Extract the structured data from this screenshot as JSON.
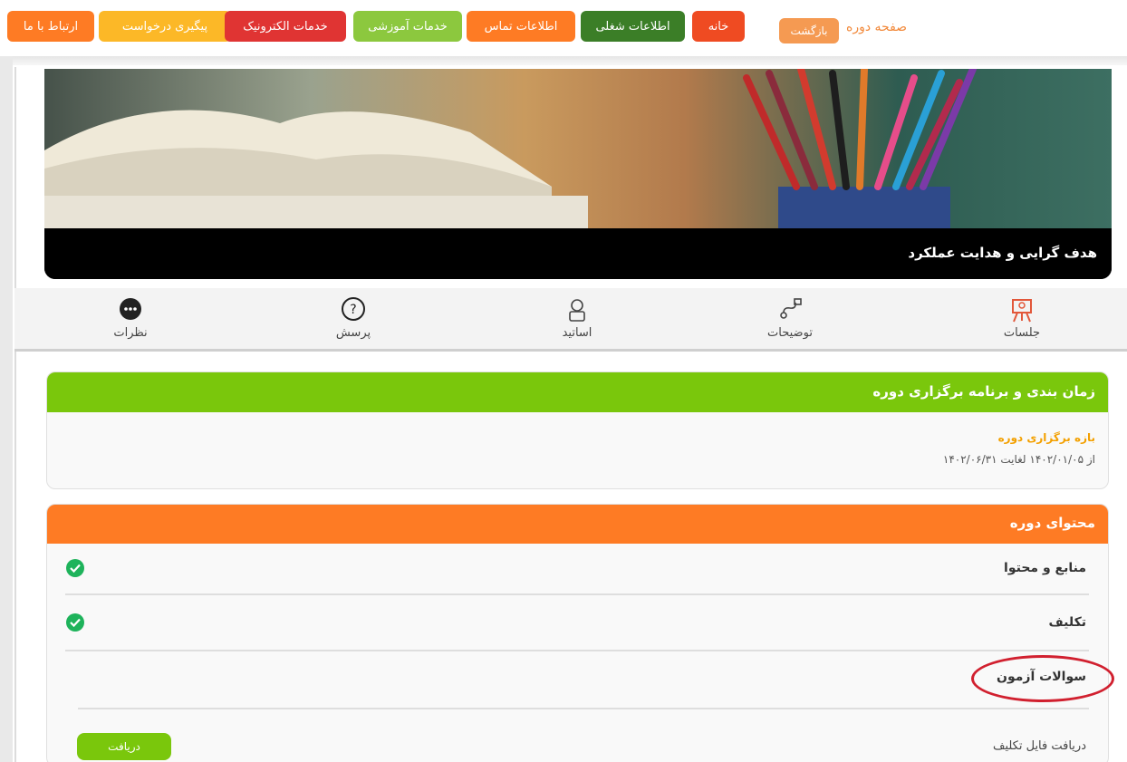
{
  "header": {
    "page_title": "صفحه دوره",
    "back_label": "بازگشت",
    "nav": [
      {
        "label": "ارتباط با ما",
        "color": "#fe7b24"
      },
      {
        "label": "پیگیری درخواست",
        "color": "#fcb827"
      },
      {
        "label": "خدمات الکترونیک",
        "color": "#e03433"
      },
      {
        "label": "خدمات آموزشی",
        "color": "#8cc83e"
      },
      {
        "label": "اطلاعات تماس",
        "color": "#fe7b24"
      },
      {
        "label": "اطلاعات شغلی",
        "color": "#3b7e27"
      },
      {
        "label": "خانه",
        "color": "#ef4b22"
      }
    ]
  },
  "banner": {
    "title": "هدف گرایی و هدایت عملکرد"
  },
  "tabs": [
    {
      "label": "جلسات",
      "icon": "presentation-icon",
      "active": true
    },
    {
      "label": "توضیحات",
      "icon": "route-icon",
      "active": false
    },
    {
      "label": "اساتید",
      "icon": "teacher-icon",
      "active": false
    },
    {
      "label": "پرسش",
      "icon": "question-icon",
      "active": false
    },
    {
      "label": "نظرات",
      "icon": "comment-icon",
      "active": false
    }
  ],
  "schedule": {
    "title": "زمان بندی و برنامه برگزاری دوره",
    "subtitle": "بازه برگزاری دوره",
    "range": "از ۱۴۰۲/۰۱/۰۵ لغایت ۱۴۰۲/۰۶/۳۱"
  },
  "content": {
    "title": "محتوای دوره",
    "items": [
      {
        "label": "منابع و محتوا",
        "done": true
      },
      {
        "label": "تکلیف",
        "done": true
      },
      {
        "label": "سوالات آزمون",
        "done": false
      }
    ],
    "download_label": "دریافت فایل تکلیف",
    "download_button": "دریافت"
  },
  "colors": {
    "green": "#7ac70c",
    "orange": "#fe7b24",
    "check": "#1eb35b",
    "annotation": "#d1202f"
  }
}
